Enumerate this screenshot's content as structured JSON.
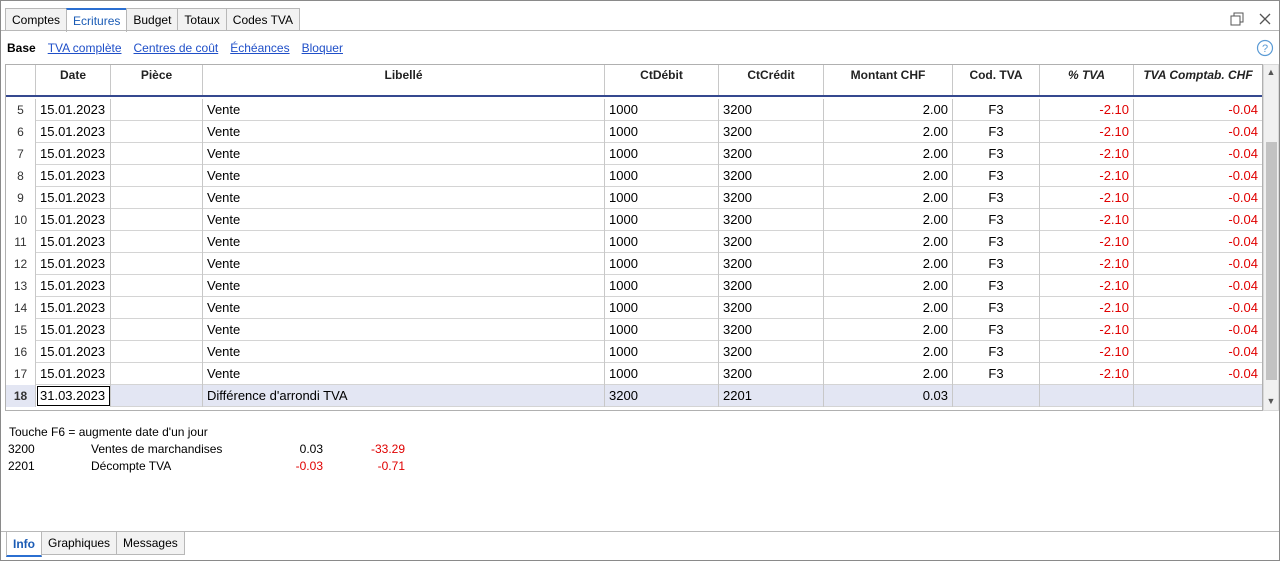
{
  "top_tabs": [
    {
      "label": "Comptes"
    },
    {
      "label": "Ecritures",
      "active": true
    },
    {
      "label": "Budget"
    },
    {
      "label": "Totaux"
    },
    {
      "label": "Codes TVA"
    }
  ],
  "sub_tabs": [
    {
      "label": "Base",
      "active": true
    },
    {
      "label": "TVA complète"
    },
    {
      "label": "Centres de coût"
    },
    {
      "label": "Échéances"
    },
    {
      "label": "Bloquer"
    }
  ],
  "table": {
    "columns": [
      "",
      "Date",
      "Pièce",
      "Libellé",
      "CtDébit",
      "CtCrédit",
      "Montant CHF",
      "Cod. TVA",
      "% TVA",
      "TVA Comptab. CHF"
    ],
    "rows": [
      {
        "n": "5",
        "date": "15.01.2023",
        "piece": "",
        "libelle": "Vente",
        "debit": "1000",
        "credit": "3200",
        "montant": "2.00",
        "code": "F3",
        "pct": "-2.10",
        "tva": "-0.04"
      },
      {
        "n": "6",
        "date": "15.01.2023",
        "piece": "",
        "libelle": "Vente",
        "debit": "1000",
        "credit": "3200",
        "montant": "2.00",
        "code": "F3",
        "pct": "-2.10",
        "tva": "-0.04"
      },
      {
        "n": "7",
        "date": "15.01.2023",
        "piece": "",
        "libelle": "Vente",
        "debit": "1000",
        "credit": "3200",
        "montant": "2.00",
        "code": "F3",
        "pct": "-2.10",
        "tva": "-0.04"
      },
      {
        "n": "8",
        "date": "15.01.2023",
        "piece": "",
        "libelle": "Vente",
        "debit": "1000",
        "credit": "3200",
        "montant": "2.00",
        "code": "F3",
        "pct": "-2.10",
        "tva": "-0.04"
      },
      {
        "n": "9",
        "date": "15.01.2023",
        "piece": "",
        "libelle": "Vente",
        "debit": "1000",
        "credit": "3200",
        "montant": "2.00",
        "code": "F3",
        "pct": "-2.10",
        "tva": "-0.04"
      },
      {
        "n": "10",
        "date": "15.01.2023",
        "piece": "",
        "libelle": "Vente",
        "debit": "1000",
        "credit": "3200",
        "montant": "2.00",
        "code": "F3",
        "pct": "-2.10",
        "tva": "-0.04"
      },
      {
        "n": "11",
        "date": "15.01.2023",
        "piece": "",
        "libelle": "Vente",
        "debit": "1000",
        "credit": "3200",
        "montant": "2.00",
        "code": "F3",
        "pct": "-2.10",
        "tva": "-0.04"
      },
      {
        "n": "12",
        "date": "15.01.2023",
        "piece": "",
        "libelle": "Vente",
        "debit": "1000",
        "credit": "3200",
        "montant": "2.00",
        "code": "F3",
        "pct": "-2.10",
        "tva": "-0.04"
      },
      {
        "n": "13",
        "date": "15.01.2023",
        "piece": "",
        "libelle": "Vente",
        "debit": "1000",
        "credit": "3200",
        "montant": "2.00",
        "code": "F3",
        "pct": "-2.10",
        "tva": "-0.04"
      },
      {
        "n": "14",
        "date": "15.01.2023",
        "piece": "",
        "libelle": "Vente",
        "debit": "1000",
        "credit": "3200",
        "montant": "2.00",
        "code": "F3",
        "pct": "-2.10",
        "tva": "-0.04"
      },
      {
        "n": "15",
        "date": "15.01.2023",
        "piece": "",
        "libelle": "Vente",
        "debit": "1000",
        "credit": "3200",
        "montant": "2.00",
        "code": "F3",
        "pct": "-2.10",
        "tva": "-0.04"
      },
      {
        "n": "16",
        "date": "15.01.2023",
        "piece": "",
        "libelle": "Vente",
        "debit": "1000",
        "credit": "3200",
        "montant": "2.00",
        "code": "F3",
        "pct": "-2.10",
        "tva": "-0.04"
      },
      {
        "n": "17",
        "date": "15.01.2023",
        "piece": "",
        "libelle": "Vente",
        "debit": "1000",
        "credit": "3200",
        "montant": "2.00",
        "code": "F3",
        "pct": "-2.10",
        "tva": "-0.04"
      },
      {
        "n": "18",
        "date": "31.03.2023",
        "piece": "",
        "libelle": "Différence d'arrondi TVA",
        "debit": "3200",
        "credit": "2201",
        "montant": "0.03",
        "code": "",
        "pct": "",
        "tva": "",
        "selected": true
      }
    ]
  },
  "info": {
    "hint": "Touche F6 = augmente date d'un jour",
    "accounts": [
      {
        "account": "3200",
        "name": "Ventes de marchandises",
        "amount": "0.03",
        "balance": "-33.29"
      },
      {
        "account": "2201",
        "name": "Décompte TVA",
        "amount": "-0.03",
        "balance": "-0.71"
      }
    ]
  },
  "bottom_tabs": [
    {
      "label": "Info",
      "active": true
    },
    {
      "label": "Graphiques"
    },
    {
      "label": "Messages"
    }
  ],
  "colors": {
    "negative": "#e00000",
    "link": "#1f4fc8",
    "accent": "#2b6fd1",
    "header_rule": "#35488f"
  }
}
